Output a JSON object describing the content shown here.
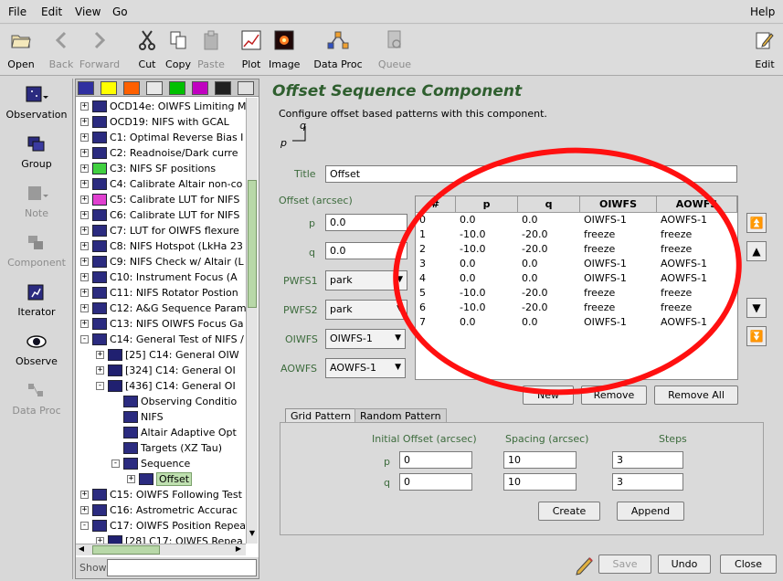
{
  "menubar": {
    "items": [
      "File",
      "Edit",
      "View",
      "Go"
    ],
    "help": "Help"
  },
  "toolbar": {
    "items": [
      {
        "label": "Open",
        "icon": "folder-open-icon",
        "enabled": true
      },
      {
        "label": "Back",
        "icon": "arrow-left-icon",
        "enabled": false
      },
      {
        "label": "Forward",
        "icon": "arrow-right-icon",
        "enabled": false
      },
      {
        "label": "Cut",
        "icon": "scissors-icon",
        "enabled": true
      },
      {
        "label": "Copy",
        "icon": "copy-icon",
        "enabled": true
      },
      {
        "label": "Paste",
        "icon": "clipboard-icon",
        "enabled": false
      },
      {
        "label": "Plot",
        "icon": "plot-icon",
        "enabled": true
      },
      {
        "label": "Image",
        "icon": "image-icon",
        "enabled": true
      },
      {
        "label": "Data Proc",
        "icon": "data-proc-icon",
        "enabled": true
      },
      {
        "label": "Queue",
        "icon": "queue-icon",
        "enabled": false
      }
    ],
    "edit": "Edit"
  },
  "sidebar": {
    "items": [
      {
        "label": "Observation",
        "enabled": true
      },
      {
        "label": "Group",
        "enabled": true
      },
      {
        "label": "Note",
        "enabled": false
      },
      {
        "label": "Component",
        "enabled": false
      },
      {
        "label": "Iterator",
        "enabled": true
      },
      {
        "label": "Observe",
        "enabled": true
      },
      {
        "label": "Data Proc",
        "enabled": false
      }
    ]
  },
  "colors": {
    "accent": "#3c6b3c",
    "title": "#2f5f2f",
    "oval": "#ff1010",
    "swatches": [
      "#3030a0",
      "#ffff00",
      "#ff6000",
      "#e8e8e8",
      "#00c000",
      "#c000c0",
      "#202020",
      "#e0e0e0"
    ]
  },
  "tree": {
    "rows": [
      {
        "label": "OCD14e:  OIWFS Limiting M",
        "indent": 0,
        "exp": "+",
        "color": "#2b2b80"
      },
      {
        "label": "OCD19:  NIFS with GCAL",
        "indent": 0,
        "exp": "+",
        "color": "#2b2b80"
      },
      {
        "label": "C1:  Optimal Reverse Bias I",
        "indent": 0,
        "exp": "+",
        "color": "#2b2b80"
      },
      {
        "label": "C2: Readnoise/Dark curre",
        "indent": 0,
        "exp": "+",
        "color": "#2b2b80"
      },
      {
        "label": "C3: NIFS SF positions",
        "indent": 0,
        "exp": "+",
        "color": "#40d040"
      },
      {
        "label": "C4: Calibrate Altair non-co",
        "indent": 0,
        "exp": "+",
        "color": "#2b2b80"
      },
      {
        "label": "C5:  Calibrate LUT for NIFS",
        "indent": 0,
        "exp": "+",
        "color": "#e040d0"
      },
      {
        "label": "C6:  Calibrate LUT for NIFS",
        "indent": 0,
        "exp": "+",
        "color": "#2b2b80"
      },
      {
        "label": "C7: LUT for OIWFS flexure",
        "indent": 0,
        "exp": "+",
        "color": "#2b2b80"
      },
      {
        "label": "C8: NIFS Hotspot (LkHa 23",
        "indent": 0,
        "exp": "+",
        "color": "#2b2b80"
      },
      {
        "label": "C9: NIFS Check w/ Altair (L",
        "indent": 0,
        "exp": "+",
        "color": "#2b2b80"
      },
      {
        "label": "C10: Instrument Focus (A",
        "indent": 0,
        "exp": "+",
        "color": "#2b2b80"
      },
      {
        "label": "C11: NIFS Rotator Postion",
        "indent": 0,
        "exp": "+",
        "color": "#2b2b80"
      },
      {
        "label": "C12: A&G Sequence Param",
        "indent": 0,
        "exp": "+",
        "color": "#2b2b80"
      },
      {
        "label": "C13: NIFS OIWFS Focus Ga",
        "indent": 0,
        "exp": "+",
        "color": "#2b2b80"
      },
      {
        "label": "C14: General Test of NIFS /",
        "indent": 0,
        "exp": "-",
        "color": "#2b2b80"
      },
      {
        "label": "[25] C14:  General OIW",
        "indent": 1,
        "exp": "+",
        "color": "#202070"
      },
      {
        "label": "[324] C14:  General OI",
        "indent": 1,
        "exp": "+",
        "color": "#202070"
      },
      {
        "label": "[436] C14:  General OI",
        "indent": 1,
        "exp": "-",
        "color": "#202070"
      },
      {
        "label": "Observing Conditio",
        "indent": 2,
        "exp": "",
        "color": "#2b2b80"
      },
      {
        "label": "NIFS",
        "indent": 2,
        "exp": "",
        "color": "#2b2b80"
      },
      {
        "label": "Altair Adaptive Opt",
        "indent": 2,
        "exp": "",
        "color": "#2b2b80"
      },
      {
        "label": "Targets (XZ Tau)",
        "indent": 2,
        "exp": "",
        "color": "#2b2b80"
      },
      {
        "label": "Sequence",
        "indent": 2,
        "exp": "-",
        "color": "#2b2b80"
      },
      {
        "label": "Offset",
        "indent": 3,
        "exp": "+",
        "color": "#2b2b80",
        "selected": true
      },
      {
        "label": "C15: OIWFS Following Test",
        "indent": 0,
        "exp": "+",
        "color": "#2b2b80"
      },
      {
        "label": "C16: Astrometric Accurac",
        "indent": 0,
        "exp": "+",
        "color": "#2b2b80"
      },
      {
        "label": "C17: OIWFS Position Repea",
        "indent": 0,
        "exp": "-",
        "color": "#2b2b80"
      },
      {
        "label": "[28] C17:  OIWFS Repea",
        "indent": 1,
        "exp": "+",
        "color": "#202070"
      }
    ]
  },
  "show_label": "Show",
  "component": {
    "title": "Offset Sequence Component",
    "description": "Configure offset based patterns with this component.",
    "p_axis": "p",
    "q_axis": "q",
    "title_label": "Title",
    "title_value": "Offset",
    "offset_label": "Offset (arcsec)",
    "p_label": "p",
    "p_value": "0.0",
    "q_label": "q",
    "q_value": "0.0",
    "pwfs1_label": "PWFS1",
    "pwfs1_value": "park",
    "pwfs2_label": "PWFS2",
    "pwfs2_value": "park",
    "oiwfs_label": "OIWFS",
    "oiwfs_value": "OIWFS-1",
    "aowfs_label": "AOWFS",
    "aowfs_value": "AOWFS-1"
  },
  "table": {
    "headers": [
      "#",
      "p",
      "q",
      "OIWFS",
      "AOWFS"
    ],
    "rows": [
      [
        "0",
        "0.0",
        "0.0",
        "OIWFS-1",
        "AOWFS-1"
      ],
      [
        "1",
        "-10.0",
        "-20.0",
        "freeze",
        "freeze"
      ],
      [
        "2",
        "-10.0",
        "-20.0",
        "freeze",
        "freeze"
      ],
      [
        "3",
        "0.0",
        "0.0",
        "OIWFS-1",
        "AOWFS-1"
      ],
      [
        "4",
        "0.0",
        "0.0",
        "OIWFS-1",
        "AOWFS-1"
      ],
      [
        "5",
        "-10.0",
        "-20.0",
        "freeze",
        "freeze"
      ],
      [
        "6",
        "-10.0",
        "-20.0",
        "freeze",
        "freeze"
      ],
      [
        "7",
        "0.0",
        "0.0",
        "OIWFS-1",
        "AOWFS-1"
      ]
    ]
  },
  "table_buttons": {
    "new": "New",
    "remove": "Remove",
    "remove_all": "Remove All"
  },
  "tabs": {
    "grid": "Grid Pattern",
    "random": "Random Pattern"
  },
  "grid": {
    "initial_label": "Initial Offset (arcsec)",
    "spacing_label": "Spacing (arcsec)",
    "steps_label": "Steps",
    "p_label": "p",
    "q_label": "q",
    "p_initial": "0",
    "q_initial": "0",
    "p_spacing": "10",
    "q_spacing": "10",
    "p_steps": "3",
    "q_steps": "3",
    "create": "Create",
    "append": "Append"
  },
  "bottom": {
    "save": "Save",
    "undo": "Undo",
    "close": "Close"
  }
}
